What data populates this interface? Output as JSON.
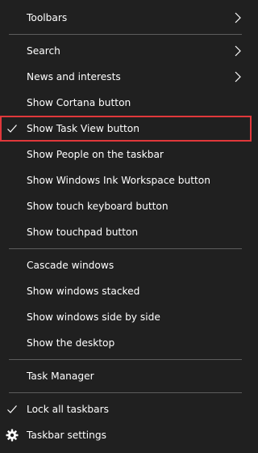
{
  "menu": {
    "items": [
      {
        "label": "Toolbars"
      },
      {
        "label": "Search"
      },
      {
        "label": "News and interests"
      },
      {
        "label": "Show Cortana button"
      },
      {
        "label": "Show Task View button",
        "checked": true,
        "highlighted": true
      },
      {
        "label": "Show People on the taskbar"
      },
      {
        "label": "Show Windows Ink Workspace button"
      },
      {
        "label": "Show touch keyboard button"
      },
      {
        "label": "Show touchpad button"
      },
      {
        "label": "Cascade windows"
      },
      {
        "label": "Show windows stacked"
      },
      {
        "label": "Show windows side by side"
      },
      {
        "label": "Show the desktop"
      },
      {
        "label": "Task Manager"
      },
      {
        "label": "Lock all taskbars",
        "checked": true
      },
      {
        "label": "Taskbar settings",
        "icon": "gear-icon"
      }
    ]
  },
  "colors": {
    "background": "#202020",
    "text": "#ffffff",
    "separator": "#5d5d5d",
    "highlight_border": "#e0383b"
  }
}
